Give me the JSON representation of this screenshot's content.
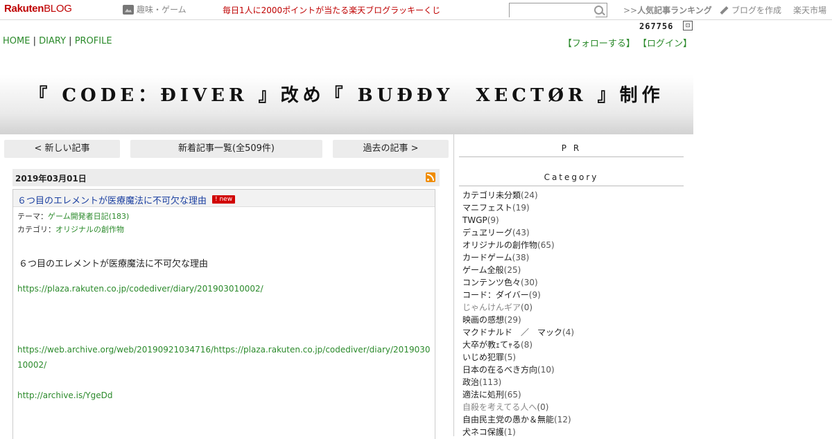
{
  "topbar": {
    "logo_main": "Rakuten",
    "logo_sub": "BLOG",
    "genre": "趣味・ゲーム",
    "lucky": "毎日1人に2000ポイントが当たる楽天ブログラッキーくじ",
    "search_placeholder": "",
    "ranking_prefix": ">>",
    "ranking": "人気記事ランキング",
    "create": "ブログを作成",
    "market": "楽天市場"
  },
  "counter": "267756",
  "nav": {
    "home": "HOME",
    "diary": "DIARY",
    "profile": "PROFILE",
    "sep": "|"
  },
  "follow": {
    "follow": "【フォローする】",
    "login": "【ログイン】"
  },
  "banner": {
    "title": "『 CODE：ĐIVER 』改め『 BUĐĐY　XECTØR 』制作"
  },
  "pager": {
    "newer": "< 新しい記事",
    "list": "新着記事一覧(全509件)",
    "older": "過去の記事 >"
  },
  "article": {
    "date": "2019年03月01日",
    "title": "６つ目のエレメントが医療魔法に不可欠な理由",
    "badge": "new",
    "theme_label": "テーマ：",
    "theme": "ゲーム開発者日記(183)",
    "category_label": "カテゴリ：",
    "category": "オリジナルの創作物",
    "body": "６つ目のエレメントが医療魔法に不可欠な理由",
    "link1": "https://plaza.rakuten.co.jp/codediver/diary/201903010002/",
    "link2": "https://web.archive.org/web/20190921034716/https://plaza.rakuten.co.jp/codediver/diary/201903010002/",
    "link3": "http://archive.is/YgeDd"
  },
  "sidebar": {
    "pr": "P R",
    "category_heading": "Category",
    "categories": [
      {
        "name": "カテゴリ未分類",
        "count": "(24)",
        "gray": false
      },
      {
        "name": "マニフェスト",
        "count": "(19)",
        "gray": false
      },
      {
        "name": "TWGP",
        "count": "(9)",
        "gray": false
      },
      {
        "name": "デュヱリーグ",
        "count": "(43)",
        "gray": false
      },
      {
        "name": "オリジナルの創作物",
        "count": "(65)",
        "gray": false
      },
      {
        "name": "カードゲーム",
        "count": "(38)",
        "gray": false
      },
      {
        "name": "ゲーム全般",
        "count": "(25)",
        "gray": false
      },
      {
        "name": "コンテンツ色々",
        "count": "(30)",
        "gray": false
      },
      {
        "name": "コード：ダイバー",
        "count": "(9)",
        "gray": false
      },
      {
        "name": "じゃんけんギア",
        "count": "(0)",
        "gray": true
      },
      {
        "name": "映画の感想",
        "count": "(29)",
        "gray": false
      },
      {
        "name": "マクドナルド　／　マック",
        "count": "(4)",
        "gray": false
      },
      {
        "name": "大卒が教ｪてｬる",
        "count": "(8)",
        "gray": false
      },
      {
        "name": "いじめ犯罪",
        "count": "(5)",
        "gray": false
      },
      {
        "name": "日本の在るべき方向",
        "count": "(10)",
        "gray": false
      },
      {
        "name": "政治",
        "count": "(113)",
        "gray": false
      },
      {
        "name": "適法に処刑",
        "count": "(65)",
        "gray": false
      },
      {
        "name": "自殺を考えてる人へ",
        "count": "(0)",
        "gray": true
      },
      {
        "name": "自由民主党の愚か＆無能",
        "count": "(12)",
        "gray": false
      },
      {
        "name": "犬ネコ保護",
        "count": "(1)",
        "gray": false
      }
    ]
  }
}
